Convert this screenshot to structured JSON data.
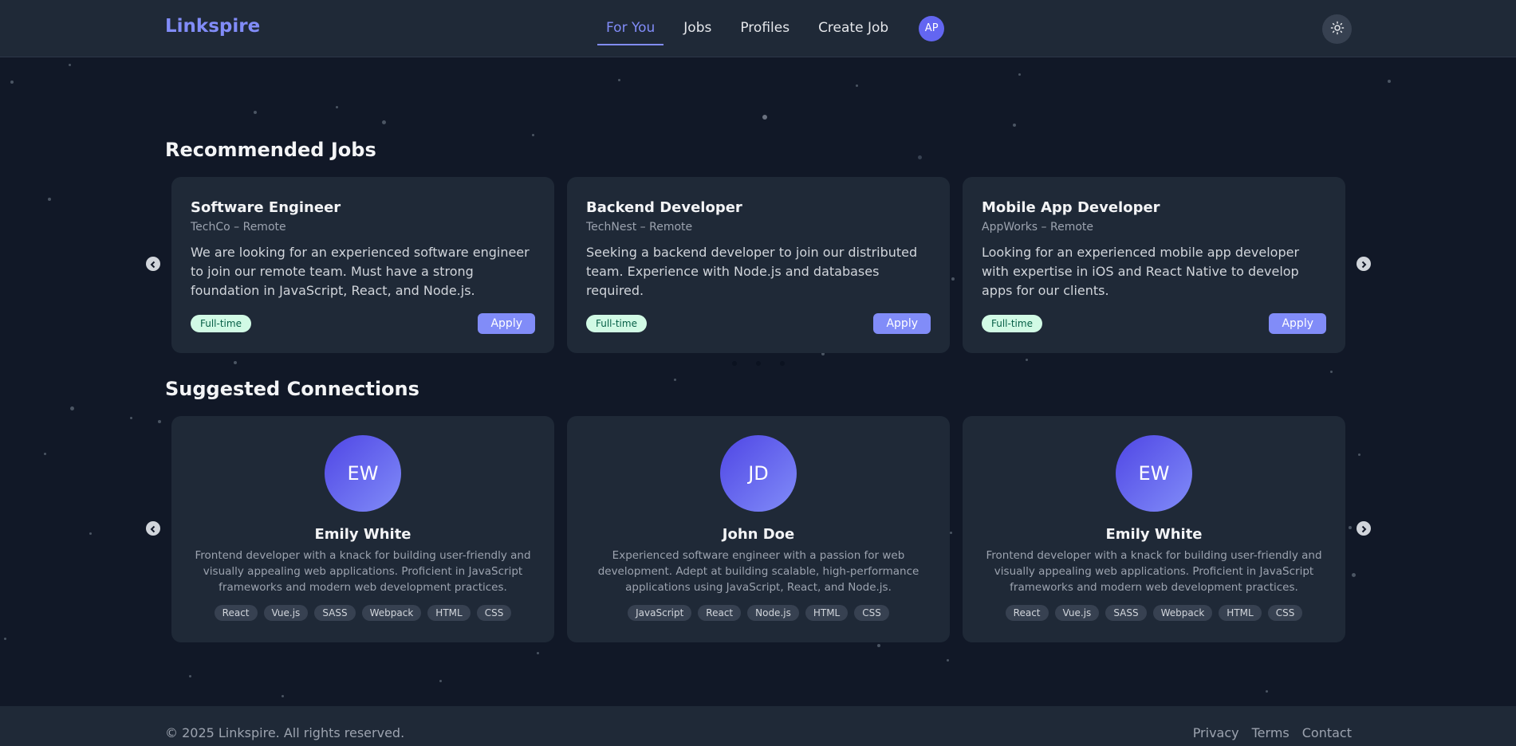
{
  "header": {
    "brand": "Linkspire",
    "nav": [
      {
        "label": "For You",
        "active": true
      },
      {
        "label": "Jobs"
      },
      {
        "label": "Profiles"
      },
      {
        "label": "Create Job"
      }
    ],
    "avatar_initials": "AP",
    "theme_icon": "sun-icon"
  },
  "recommended": {
    "title": "Recommended Jobs",
    "jobs": [
      {
        "title": "Software Engineer",
        "company": "TechCo – Remote",
        "description": "We are looking for an experienced software engineer to join our remote team. Must have a strong foundation in JavaScript, React, and Node.js.",
        "type": "Full-time",
        "apply": "Apply"
      },
      {
        "title": "Backend Developer",
        "company": "TechNest – Remote",
        "description": "Seeking a backend developer to join our distributed team. Experience with Node.js and databases required.",
        "type": "Full-time",
        "apply": "Apply"
      },
      {
        "title": "Mobile App Developer",
        "company": "AppWorks – Remote",
        "description": "Looking for an experienced mobile app developer with expertise in iOS and React Native to develop apps for our clients.",
        "type": "Full-time",
        "apply": "Apply"
      }
    ]
  },
  "connections": {
    "title": "Suggested Connections",
    "people": [
      {
        "initials": "EW",
        "name": "Emily White",
        "bio": "Frontend developer with a knack for building user-friendly and visually appealing web applications. Proficient in JavaScript frameworks and modern web development practices.",
        "skills": [
          "React",
          "Vue.js",
          "SASS",
          "Webpack",
          "HTML",
          "CSS"
        ]
      },
      {
        "initials": "JD",
        "name": "John Doe",
        "bio": "Experienced software engineer with a passion for web development. Adept at building scalable, high-performance applications using JavaScript, React, and Node.js.",
        "skills": [
          "JavaScript",
          "React",
          "Node.js",
          "HTML",
          "CSS"
        ]
      },
      {
        "initials": "EW",
        "name": "Emily White",
        "bio": "Frontend developer with a knack for building user-friendly and visually appealing web applications. Proficient in JavaScript frameworks and modern web development practices.",
        "skills": [
          "React",
          "Vue.js",
          "SASS",
          "Webpack",
          "HTML",
          "CSS"
        ]
      }
    ]
  },
  "footer": {
    "copyright": "© 2025 Linkspire. All rights reserved.",
    "links": [
      "Privacy",
      "Terms",
      "Contact"
    ]
  },
  "colors": {
    "background": "#111827",
    "card": "#1f2937",
    "accent": "#818cf8"
  }
}
